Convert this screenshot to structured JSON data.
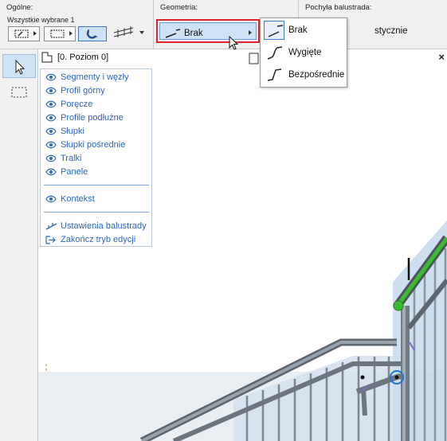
{
  "toolbar": {
    "general_label": "Ogólne:",
    "selection_label": "Wszystkie wybrane 1",
    "geometry_label": "Geometria:",
    "geometry_value": "Brak",
    "slope_label": "Pochyła balustrada:",
    "slope_value": "stycznie"
  },
  "geometry_dropdown": {
    "options": [
      {
        "label": "Brak",
        "icon": "straight-segment-icon",
        "selected": true
      },
      {
        "label": "Wygięte",
        "icon": "curved-segment-icon",
        "selected": false
      },
      {
        "label": "Bezpośrednie",
        "icon": "direct-segment-icon",
        "selected": false
      }
    ]
  },
  "canvas": {
    "story_label": "[0. Poziom 0]",
    "close_label": "×"
  },
  "panel": {
    "items": [
      {
        "label": "Segmenty i węzły"
      },
      {
        "label": "Profil górny"
      },
      {
        "label": "Poręcze"
      },
      {
        "label": "Profile podłużne"
      },
      {
        "label": "Słupki"
      },
      {
        "label": "Słupki pośrednie"
      },
      {
        "label": "Tralki"
      },
      {
        "label": "Panele"
      }
    ],
    "context_label": "Kontekst",
    "settings_label": "Ustawienia balustrady",
    "exit_label": "Zakończ tryb edycji"
  },
  "colors": {
    "accent": "#2a66c2",
    "highlight_border": "#e0242b",
    "selected_bg": "#cde2f7",
    "rail_green": "#3dbb2e"
  }
}
